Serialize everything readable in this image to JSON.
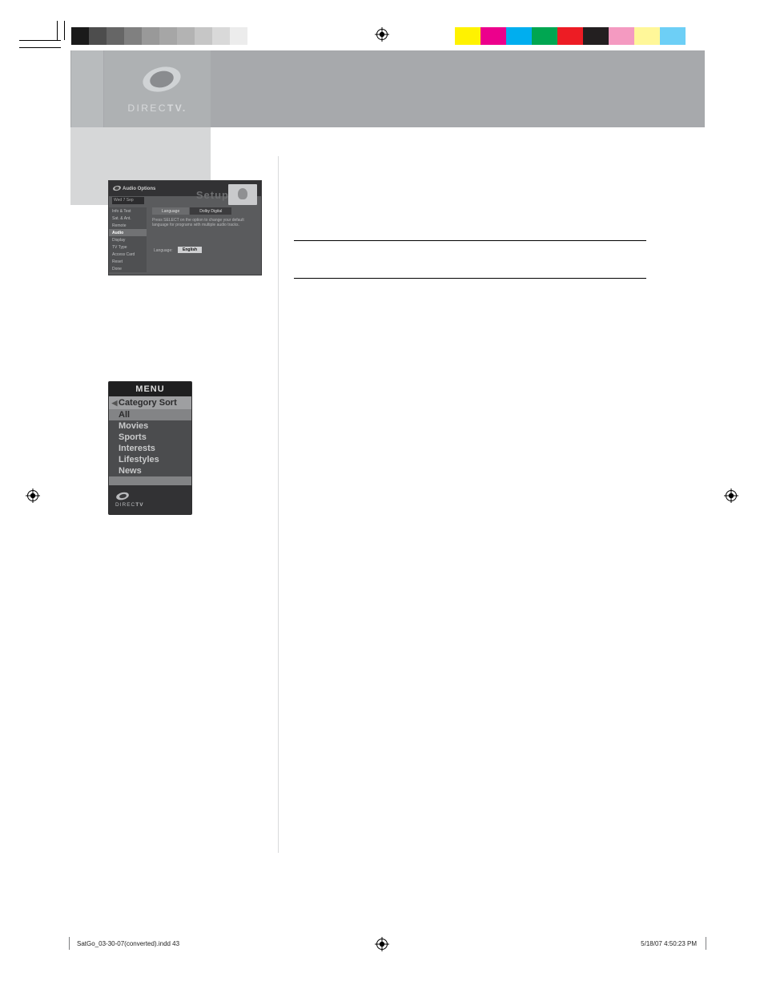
{
  "brand": {
    "logo_text_a": "DIREC",
    "logo_text_b": "TV."
  },
  "gray_strip": [
    "#1a1a1a",
    "#4d4d4d",
    "#666666",
    "#808080",
    "#999999",
    "#a6a6a6",
    "#b3b3b3",
    "#c6c6c6",
    "#d9d9d9",
    "#ececec",
    "#ffffff"
  ],
  "color_strip": [
    "#fff200",
    "#ec008c",
    "#00aeef",
    "#00a651",
    "#ed1c24",
    "#231f20",
    "#f49ac1",
    "#fff799",
    "#6dcff6"
  ],
  "audio_shot": {
    "title": "Audio Options",
    "setup": "Setup",
    "date": "Wed 7 Sep",
    "side": [
      "Info & Test",
      "Sat. & Ant.",
      "Remote",
      "Audio",
      "Display",
      "TV Type",
      "Access Card",
      "Reset",
      "Done"
    ],
    "side_selected_index": 3,
    "tabs": [
      "Language",
      "Dolby Digital"
    ],
    "tab_on_index": 0,
    "hint": "Press SELECT on the option to change your default language for programs with multiple audio tracks.",
    "lang_label": "Language:",
    "lang_value": "English"
  },
  "menu_shot": {
    "header": "MENU",
    "selector_label": "Category Sort",
    "items": [
      "All",
      "Movies",
      "Sports",
      "Interests",
      "Lifestyles",
      "News"
    ],
    "highlighted_index": 0,
    "footer_brand_a": "DIREC",
    "footer_brand_b": "TV"
  },
  "footer": {
    "left": "SatGo_03-30-07(converted).indd   43",
    "right": "5/18/07   4:50:23 PM"
  }
}
